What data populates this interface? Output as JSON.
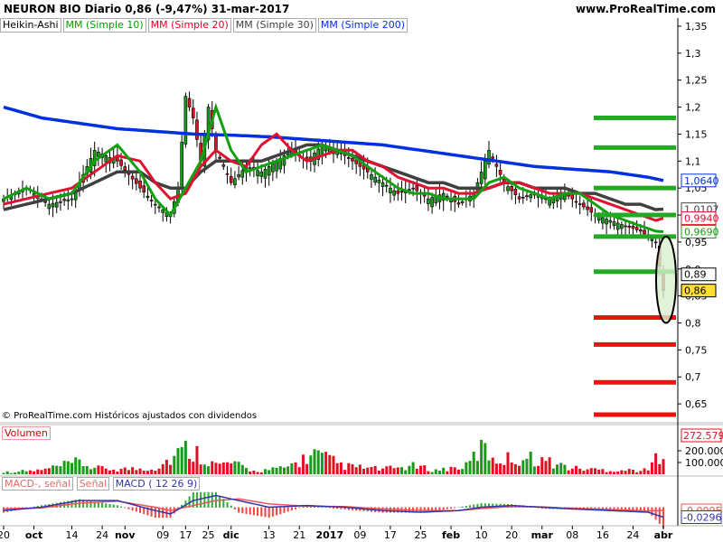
{
  "header": {
    "title_left": "NEURON BIO  Diario  0,86 (-9,47%)  31-mar-2017",
    "title_right": "www.ProRealTime.com"
  },
  "legend": {
    "items": [
      {
        "label": "Heikin-Ashi",
        "color": "#000000"
      },
      {
        "label": "MM (Simple 10)",
        "color": "#00a000"
      },
      {
        "label": "MM (Simple 20)",
        "color": "#e00020"
      },
      {
        "label": "MM (Simple 30)",
        "color": "#404040"
      },
      {
        "label": "MM (Simple 200)",
        "color": "#0030e0"
      }
    ]
  },
  "footer_note": "© ProRealTime.com  Históricos ajustados con dividendos",
  "volume_panel": {
    "label": "Volumen",
    "last_value": "272.579"
  },
  "macd_panel": {
    "label1": "MACD-, señal",
    "label2": "Señal",
    "label3": "MACD ( 12 26 9)",
    "value1": "-0,0095",
    "value2": "-0,0296"
  },
  "colors": {
    "bull": "#1a9a1a",
    "bear": "#e01020",
    "ma10": "#10a010",
    "ma20": "#e01030",
    "ma30": "#404040",
    "ma200": "#0030e0",
    "hline_green": "#22aa22",
    "hline_red": "#ee1111"
  },
  "chart_data": {
    "type": "candlestick",
    "ylim": [
      0.615,
      1.365
    ],
    "y_ticks": [
      "1,35",
      "1,3",
      "1,25",
      "1,2",
      "1,15",
      "1,1",
      "1,05",
      "1",
      "0,95",
      "0,9",
      "0,85",
      "0,8",
      "0,75",
      "0,7",
      "0,65"
    ],
    "y_tick_values": [
      1.35,
      1.3,
      1.25,
      1.2,
      1.15,
      1.1,
      1.05,
      1.0,
      0.95,
      0.9,
      0.85,
      0.8,
      0.75,
      0.7,
      0.65
    ],
    "x_ticks": [
      "20",
      "oct",
      "14",
      "24",
      "nov",
      "09",
      "17",
      "25",
      "dic",
      "13",
      "21",
      "2017",
      "09",
      "17",
      "25",
      "feb",
      "10",
      "20",
      "mar",
      "08",
      "16",
      "24",
      "abr"
    ],
    "x_tick_index": [
      0,
      8,
      18,
      26,
      32,
      42,
      48,
      54,
      60,
      70,
      78,
      86,
      94,
      102,
      110,
      118,
      126,
      134,
      142,
      150,
      158,
      166,
      174
    ],
    "price_labels": [
      {
        "text": "1,0640",
        "value": 1.064,
        "color": "#0030e0"
      },
      {
        "text": "1,0107",
        "value": 1.0107,
        "color": "#404040"
      },
      {
        "text": "0,9940",
        "value": 0.994,
        "color": "#e01030"
      },
      {
        "text": "0,9690",
        "value": 0.969,
        "color": "#10a010"
      },
      {
        "text": "0,89",
        "value": 0.89,
        "color": "#000000"
      },
      {
        "text": "0,86",
        "value": 0.86,
        "color": "#000000"
      }
    ],
    "horizontal_levels": [
      {
        "value": 1.18,
        "color": "green"
      },
      {
        "value": 1.125,
        "color": "green"
      },
      {
        "value": 1.05,
        "color": "green"
      },
      {
        "value": 1.0,
        "color": "green"
      },
      {
        "value": 0.96,
        "color": "green"
      },
      {
        "value": 0.895,
        "color": "green"
      },
      {
        "value": 0.81,
        "color": "red"
      },
      {
        "value": 0.76,
        "color": "red"
      },
      {
        "value": 0.69,
        "color": "red"
      },
      {
        "value": 0.63,
        "color": "red"
      }
    ],
    "anchors": {
      "close": [
        [
          0,
          1.03
        ],
        [
          6,
          1.05
        ],
        [
          12,
          1.02
        ],
        [
          18,
          1.03
        ],
        [
          24,
          1.12
        ],
        [
          30,
          1.1
        ],
        [
          36,
          1.05
        ],
        [
          40,
          1.02
        ],
        [
          44,
          1.0
        ],
        [
          46,
          1.05
        ],
        [
          48,
          1.22
        ],
        [
          50,
          1.18
        ],
        [
          52,
          1.1
        ],
        [
          54,
          1.2
        ],
        [
          56,
          1.12
        ],
        [
          60,
          1.06
        ],
        [
          64,
          1.09
        ],
        [
          68,
          1.08
        ],
        [
          72,
          1.1
        ],
        [
          76,
          1.12
        ],
        [
          80,
          1.1
        ],
        [
          84,
          1.13
        ],
        [
          88,
          1.12
        ],
        [
          92,
          1.1
        ],
        [
          96,
          1.08
        ],
        [
          100,
          1.06
        ],
        [
          104,
          1.04
        ],
        [
          108,
          1.05
        ],
        [
          112,
          1.03
        ],
        [
          116,
          1.04
        ],
        [
          120,
          1.02
        ],
        [
          124,
          1.04
        ],
        [
          128,
          1.12
        ],
        [
          132,
          1.06
        ],
        [
          136,
          1.03
        ],
        [
          140,
          1.04
        ],
        [
          144,
          1.03
        ],
        [
          148,
          1.04
        ],
        [
          152,
          1.02
        ],
        [
          156,
          1.0
        ],
        [
          160,
          0.99
        ],
        [
          164,
          0.98
        ],
        [
          168,
          0.97
        ],
        [
          172,
          0.95
        ],
        [
          174,
          0.86
        ]
      ],
      "ma10": [
        [
          0,
          1.03
        ],
        [
          6,
          1.05
        ],
        [
          12,
          1.03
        ],
        [
          18,
          1.04
        ],
        [
          24,
          1.1
        ],
        [
          30,
          1.13
        ],
        [
          36,
          1.08
        ],
        [
          40,
          1.03
        ],
        [
          44,
          1.0
        ],
        [
          48,
          1.05
        ],
        [
          52,
          1.1
        ],
        [
          56,
          1.2
        ],
        [
          60,
          1.12
        ],
        [
          64,
          1.08
        ],
        [
          68,
          1.09
        ],
        [
          72,
          1.1
        ],
        [
          76,
          1.11
        ],
        [
          80,
          1.12
        ],
        [
          84,
          1.13
        ],
        [
          88,
          1.12
        ],
        [
          92,
          1.11
        ],
        [
          96,
          1.09
        ],
        [
          100,
          1.07
        ],
        [
          104,
          1.05
        ],
        [
          108,
          1.04
        ],
        [
          112,
          1.04
        ],
        [
          116,
          1.03
        ],
        [
          120,
          1.03
        ],
        [
          124,
          1.03
        ],
        [
          128,
          1.06
        ],
        [
          132,
          1.07
        ],
        [
          136,
          1.05
        ],
        [
          140,
          1.04
        ],
        [
          144,
          1.03
        ],
        [
          148,
          1.04
        ],
        [
          152,
          1.04
        ],
        [
          156,
          1.02
        ],
        [
          160,
          1.0
        ],
        [
          164,
          0.99
        ],
        [
          168,
          0.98
        ],
        [
          172,
          0.97
        ],
        [
          174,
          0.969
        ]
      ],
      "ma20": [
        [
          0,
          1.02
        ],
        [
          6,
          1.03
        ],
        [
          12,
          1.04
        ],
        [
          18,
          1.05
        ],
        [
          24,
          1.08
        ],
        [
          30,
          1.11
        ],
        [
          36,
          1.1
        ],
        [
          40,
          1.06
        ],
        [
          44,
          1.03
        ],
        [
          48,
          1.04
        ],
        [
          52,
          1.09
        ],
        [
          56,
          1.12
        ],
        [
          60,
          1.1
        ],
        [
          64,
          1.09
        ],
        [
          68,
          1.13
        ],
        [
          72,
          1.15
        ],
        [
          76,
          1.12
        ],
        [
          80,
          1.1
        ],
        [
          84,
          1.11
        ],
        [
          88,
          1.12
        ],
        [
          92,
          1.12
        ],
        [
          96,
          1.1
        ],
        [
          100,
          1.09
        ],
        [
          104,
          1.07
        ],
        [
          108,
          1.06
        ],
        [
          112,
          1.05
        ],
        [
          116,
          1.05
        ],
        [
          120,
          1.04
        ],
        [
          124,
          1.04
        ],
        [
          128,
          1.05
        ],
        [
          132,
          1.06
        ],
        [
          136,
          1.06
        ],
        [
          140,
          1.05
        ],
        [
          144,
          1.04
        ],
        [
          148,
          1.04
        ],
        [
          152,
          1.04
        ],
        [
          156,
          1.03
        ],
        [
          160,
          1.02
        ],
        [
          164,
          1.01
        ],
        [
          168,
          1.0
        ],
        [
          172,
          0.99
        ],
        [
          174,
          0.994
        ]
      ],
      "ma30": [
        [
          0,
          1.01
        ],
        [
          6,
          1.02
        ],
        [
          12,
          1.03
        ],
        [
          18,
          1.04
        ],
        [
          24,
          1.06
        ],
        [
          30,
          1.08
        ],
        [
          36,
          1.08
        ],
        [
          40,
          1.06
        ],
        [
          44,
          1.05
        ],
        [
          48,
          1.05
        ],
        [
          52,
          1.08
        ],
        [
          56,
          1.1
        ],
        [
          60,
          1.1
        ],
        [
          64,
          1.1
        ],
        [
          68,
          1.1
        ],
        [
          72,
          1.11
        ],
        [
          76,
          1.12
        ],
        [
          80,
          1.13
        ],
        [
          84,
          1.13
        ],
        [
          88,
          1.12
        ],
        [
          92,
          1.11
        ],
        [
          96,
          1.1
        ],
        [
          100,
          1.09
        ],
        [
          104,
          1.08
        ],
        [
          108,
          1.07
        ],
        [
          112,
          1.06
        ],
        [
          116,
          1.06
        ],
        [
          120,
          1.05
        ],
        [
          124,
          1.05
        ],
        [
          128,
          1.05
        ],
        [
          132,
          1.06
        ],
        [
          136,
          1.06
        ],
        [
          140,
          1.05
        ],
        [
          144,
          1.05
        ],
        [
          148,
          1.05
        ],
        [
          152,
          1.04
        ],
        [
          156,
          1.04
        ],
        [
          160,
          1.03
        ],
        [
          164,
          1.02
        ],
        [
          168,
          1.02
        ],
        [
          172,
          1.01
        ],
        [
          174,
          1.0107
        ]
      ],
      "ma200": [
        [
          0,
          1.2
        ],
        [
          10,
          1.18
        ],
        [
          20,
          1.17
        ],
        [
          30,
          1.16
        ],
        [
          40,
          1.155
        ],
        [
          50,
          1.15
        ],
        [
          60,
          1.148
        ],
        [
          70,
          1.145
        ],
        [
          80,
          1.14
        ],
        [
          90,
          1.135
        ],
        [
          100,
          1.13
        ],
        [
          110,
          1.12
        ],
        [
          120,
          1.11
        ],
        [
          130,
          1.1
        ],
        [
          140,
          1.09
        ],
        [
          150,
          1.085
        ],
        [
          160,
          1.08
        ],
        [
          170,
          1.07
        ],
        [
          174,
          1.064
        ]
      ],
      "volume": [
        [
          0,
          20000
        ],
        [
          10,
          40000
        ],
        [
          20,
          120000
        ],
        [
          24,
          60000
        ],
        [
          30,
          50000
        ],
        [
          40,
          60000
        ],
        [
          48,
          250000
        ],
        [
          52,
          200000
        ],
        [
          56,
          90000
        ],
        [
          60,
          110000
        ],
        [
          66,
          30000
        ],
        [
          74,
          60000
        ],
        [
          82,
          200000
        ],
        [
          90,
          80000
        ],
        [
          100,
          50000
        ],
        [
          108,
          80000
        ],
        [
          114,
          40000
        ],
        [
          122,
          80000
        ],
        [
          126,
          260000
        ],
        [
          130,
          150000
        ],
        [
          140,
          160000
        ],
        [
          150,
          60000
        ],
        [
          160,
          40000
        ],
        [
          170,
          40000
        ],
        [
          174,
          272579
        ]
      ],
      "macd": [
        [
          0,
          -0.01
        ],
        [
          10,
          0.0
        ],
        [
          20,
          0.02
        ],
        [
          30,
          0.02
        ],
        [
          40,
          -0.01
        ],
        [
          44,
          -0.02
        ],
        [
          50,
          0.02
        ],
        [
          56,
          0.035
        ],
        [
          62,
          0.02
        ],
        [
          70,
          0.0
        ],
        [
          80,
          0.005
        ],
        [
          90,
          0.0
        ],
        [
          100,
          -0.01
        ],
        [
          110,
          -0.015
        ],
        [
          120,
          -0.01
        ],
        [
          126,
          0.0
        ],
        [
          134,
          0.005
        ],
        [
          142,
          0.0
        ],
        [
          150,
          -0.005
        ],
        [
          160,
          -0.01
        ],
        [
          170,
          -0.015
        ],
        [
          174,
          -0.0296
        ]
      ],
      "signal": [
        [
          0,
          -0.005
        ],
        [
          10,
          -0.002
        ],
        [
          20,
          0.012
        ],
        [
          30,
          0.018
        ],
        [
          40,
          0.0
        ],
        [
          44,
          -0.01
        ],
        [
          50,
          0.005
        ],
        [
          56,
          0.02
        ],
        [
          62,
          0.025
        ],
        [
          70,
          0.01
        ],
        [
          80,
          0.003
        ],
        [
          90,
          0.002
        ],
        [
          100,
          -0.005
        ],
        [
          110,
          -0.01
        ],
        [
          120,
          -0.01
        ],
        [
          126,
          -0.004
        ],
        [
          134,
          0.002
        ],
        [
          142,
          0.001
        ],
        [
          150,
          -0.003
        ],
        [
          160,
          -0.007
        ],
        [
          170,
          -0.011
        ],
        [
          174,
          -0.0095
        ]
      ]
    },
    "series_length": 175
  }
}
